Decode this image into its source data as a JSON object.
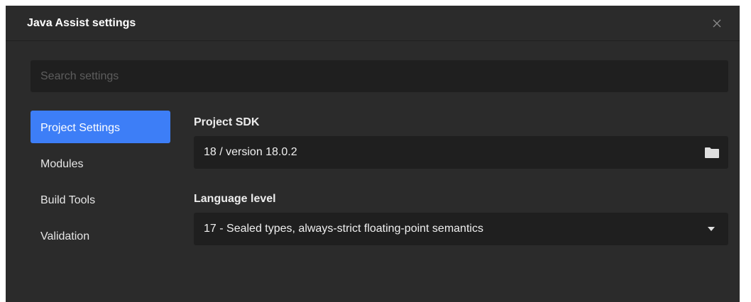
{
  "dialog": {
    "title": "Java Assist settings",
    "close_icon": "close-icon"
  },
  "search": {
    "placeholder": "Search settings",
    "value": ""
  },
  "sidebar": {
    "items": [
      {
        "label": "Project Settings",
        "active": true
      },
      {
        "label": "Modules",
        "active": false
      },
      {
        "label": "Build Tools",
        "active": false
      },
      {
        "label": "Validation",
        "active": false
      }
    ]
  },
  "main": {
    "project_sdk": {
      "label": "Project SDK",
      "value": "18 / version 18.0.2",
      "icon": "folder-icon"
    },
    "language_level": {
      "label": "Language level",
      "value": "17 - Sealed types, always-strict floating-point semantics",
      "icon": "caret-down-icon"
    }
  },
  "colors": {
    "dialog_bg": "#2b2b2b",
    "input_bg": "#1f1f1f",
    "accent": "#3d7ef7"
  }
}
